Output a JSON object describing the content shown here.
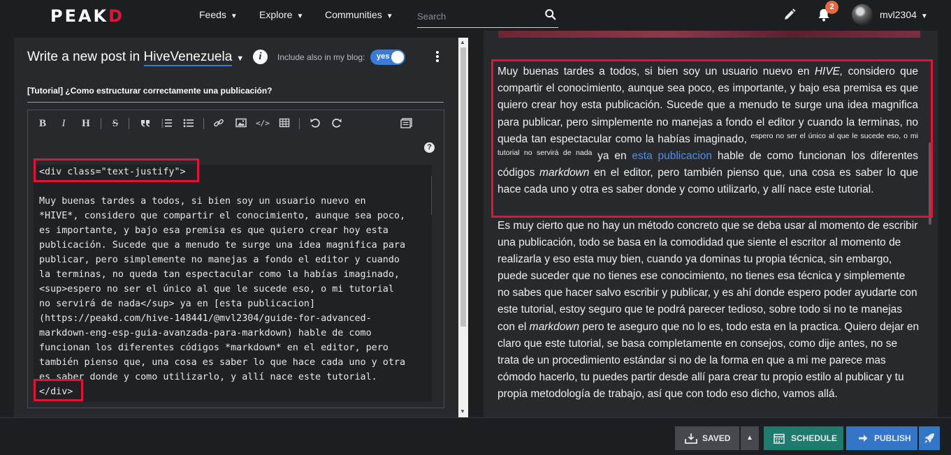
{
  "header": {
    "logo_main": "PEAK",
    "logo_accent": "D",
    "nav": [
      "Feeds",
      "Explore",
      "Communities"
    ],
    "search_placeholder": "Search",
    "notification_count": "2",
    "username": "mvl2304"
  },
  "editor": {
    "title_prefix": "Write a new post in",
    "community": "HiveVenezuela",
    "include_label": "Include also in my blog:",
    "toggle_value": "yes",
    "post_title": "[Tutorial] ¿Como estructurar correctamente una publicación?",
    "toolbar_items": [
      "bold",
      "italic",
      "heading",
      "strikethrough",
      "quote",
      "ordered-list",
      "unordered-list",
      "link",
      "image",
      "code",
      "table",
      "undo",
      "redo",
      "snippets"
    ],
    "code_lines": [
      "<div class=\"text-justify\">",
      "",
      "Muy buenas tardes a todos, si bien soy un usuario nuevo en",
      "*HIVE*, considero que compartir el conocimiento, aunque sea poco,",
      "es importante, y bajo esa premisa es que quiero crear hoy esta",
      "publicación. Sucede que a menudo te surge una idea magnifica para",
      "publicar, pero simplemente no manejas a fondo el editor y cuando",
      "la terminas, no queda tan espectacular como la habías imaginado,",
      "<sup>espero no ser el único al que le sucede eso, o mi tutorial",
      "no servirá de nada</sup> ya en [esta publicacion]",
      "(https://peakd.com/hive-148441/@mvl2304/guide-for-advanced-",
      "markdown-eng-esp-guia-avanzada-para-markdown) hable de como",
      "funcionan los diferentes códigos *markdown* en el editor, pero",
      "también pienso que, una cosa es saber lo que hace cada uno y otra",
      "es saber donde y como utilizarlo, y allí nace este tutorial.",
      "</div>"
    ]
  },
  "preview": {
    "p1_a": "Muy buenas tardes a todos, si bien soy un usuario nuevo en ",
    "p1_hive": "HIVE,",
    "p1_b": " considero que compartir el conocimiento, aunque sea poco, es importante, y bajo esa premisa es que quiero crear hoy esta publicación. Sucede que a menudo te surge una idea magnifica para publicar, pero simplemente no manejas a fondo el editor y cuando la terminas, no queda tan espectacular como la habías imaginado, ",
    "p1_sup": "espero no ser el único al que le sucede eso, o mi tutorial no servirá de nada",
    "p1_c": " ya en ",
    "p1_link": "esta publicacion",
    "p1_d": " hable de como funcionan los diferentes códigos ",
    "p1_md": "markdown",
    "p1_e": " en el editor, pero también pienso que, una cosa es saber lo que hace cada uno y otra es saber donde y como utilizarlo, y allí nace este tutorial.",
    "p2_a": "Es muy cierto que no hay un método concreto que se deba usar al momento de escribir una publicación, todo se basa en la comodidad que siente el escritor al momento de realizarla y eso esta muy bien, cuando ya dominas tu propia técnica, sin embargo, puede suceder que no tienes ese conocimiento, no tienes esa técnica y simplemente no sabes que hacer salvo escribir y publicar, y es ahí donde espero poder ayudarte con este tutorial, estoy seguro que te podrá parecer tedioso, sobre todo si no te manejas con el ",
    "p2_md": "markdown",
    "p2_b": " pero te aseguro que no lo es, todo esta en la practica. Quiero dejar en claro que este tutorial, se basa completamente en consejos, como dije antes, no se trata de un procedimiento estándar si no de la forma en que a mi me parece mas cómodo hacerlo, tu puedes partir desde allí para crear tu propio estilo al publicar y tu propia metodología de trabajo, así que con todo eso dicho, vamos allá."
  },
  "footer": {
    "saved": "SAVED",
    "schedule": "SCHEDULE",
    "publish": "PUBLISH"
  },
  "colors": {
    "accent_red": "#e31337",
    "link_blue": "#4f8fe8",
    "toggle_blue": "#3b7bd8",
    "schedule_green": "#1e7a6c",
    "publish_blue": "#3375c7"
  }
}
